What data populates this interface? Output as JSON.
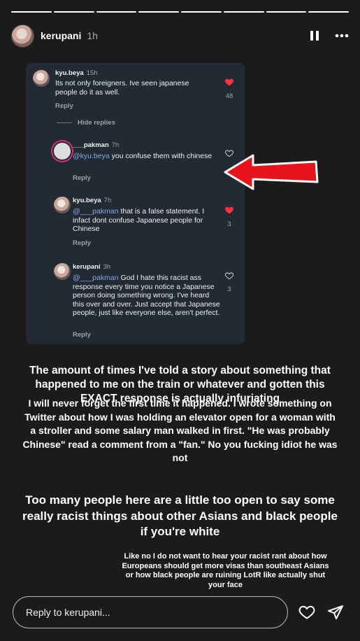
{
  "header": {
    "username": "kerupani",
    "time": "1h"
  },
  "comments": [
    {
      "user": "kyu.beya",
      "ago": "15h",
      "text": "Its not only foreigners. Ive seen japanese people do it as well.",
      "reply": "Reply",
      "likes": "48",
      "liked": true
    },
    {
      "user": "___pakman",
      "ago": "7h",
      "mention": "@kyu.beya",
      "text": " you confuse them with chinese",
      "reply": "Reply",
      "likes": "",
      "liked": false
    },
    {
      "user": "kyu.beya",
      "ago": "7h",
      "mention": "@___pakman",
      "text": " that is a false statement. I infact dont confuse Japanese people for Chinese",
      "reply": "Reply",
      "likes": "3",
      "liked": true
    },
    {
      "user": "kerupani",
      "ago": "3h",
      "mention": "@___pakman",
      "text": " God I hate this racist ass response every time you notice a Japanese person doing something wrong. I've heard this over and over. Just accept that Japanese people, just like everyone else, aren't perfect.",
      "reply": "Reply",
      "likes": "3",
      "liked": false
    }
  ],
  "hide_replies": "Hide replies",
  "paragraphs": {
    "p1": "The amount of times I've told a story about something that happened to me on the train or whatever and gotten this EXACT response is actually infuriating",
    "p2": "I will never forget the first time it happened. I wrote something on Twitter about how I was holding an elevator open for a woman with a stroller and some salary man walked in first. \"He was probably Chinese\" read a comment from a \"fan.\" No you fucking idiot he was not",
    "p3": "Too many people here are a little too open to say some really racist things about other Asians and black people if you're white",
    "p4": "Like no I do not want to hear your racist rant about how Europeans should get more visas than southeast Asians or how black people are ruining LotR like actually shut your face"
  },
  "reply_bar": {
    "placeholder": "Reply to kerupani..."
  },
  "colors": {
    "like_red": "#ff3040",
    "arrow_red": "#e8141c",
    "mention_blue": "#86a8e7"
  }
}
